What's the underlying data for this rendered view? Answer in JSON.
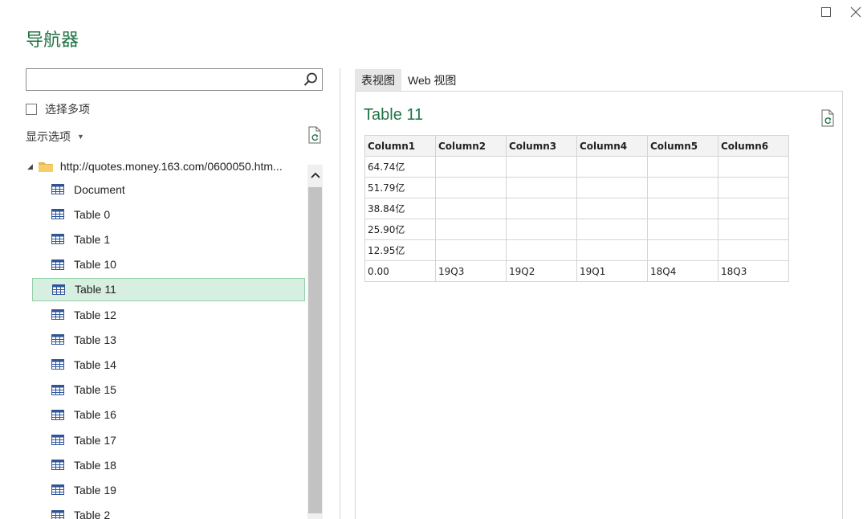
{
  "title": "导航器",
  "search": {
    "value": "",
    "placeholder": ""
  },
  "select_multiple_label": "选择多项",
  "display_options_label": "显示选项",
  "tree": {
    "root_label": "http://quotes.money.163.com/0600050.htm...",
    "items": [
      {
        "label": "Document"
      },
      {
        "label": "Table 0"
      },
      {
        "label": "Table 1"
      },
      {
        "label": "Table 10"
      },
      {
        "label": "Table 11",
        "selected": true
      },
      {
        "label": "Table 12"
      },
      {
        "label": "Table 13"
      },
      {
        "label": "Table 14"
      },
      {
        "label": "Table 15"
      },
      {
        "label": "Table 16"
      },
      {
        "label": "Table 17"
      },
      {
        "label": "Table 18"
      },
      {
        "label": "Table 19"
      },
      {
        "label": "Table 2"
      }
    ]
  },
  "tabs": [
    {
      "label": "表视图",
      "active": true
    },
    {
      "label": "Web 视图",
      "active": false
    }
  ],
  "preview": {
    "title": "Table 11",
    "columns": [
      "Column1",
      "Column2",
      "Column3",
      "Column4",
      "Column5",
      "Column6"
    ],
    "rows": [
      [
        "64.74亿",
        "",
        "",
        "",
        "",
        ""
      ],
      [
        "51.79亿",
        "",
        "",
        "",
        "",
        ""
      ],
      [
        "38.84亿",
        "",
        "",
        "",
        "",
        ""
      ],
      [
        "25.90亿",
        "",
        "",
        "",
        "",
        ""
      ],
      [
        "12.95亿",
        "",
        "",
        "",
        "",
        ""
      ],
      [
        "0.00",
        "19Q3",
        "19Q2",
        "19Q1",
        "18Q4",
        "18Q3"
      ]
    ]
  },
  "colors": {
    "accent": "#217346",
    "selected_bg": "#d7efe0",
    "selected_border": "#93cfa8",
    "table_icon": "#2f5597",
    "folder": "#e8b64c"
  },
  "icons": [
    "maximize-icon",
    "close-icon",
    "search-icon",
    "refresh-icon",
    "folder-icon",
    "table-icon",
    "chevron-up-icon",
    "caret-down-icon"
  ]
}
